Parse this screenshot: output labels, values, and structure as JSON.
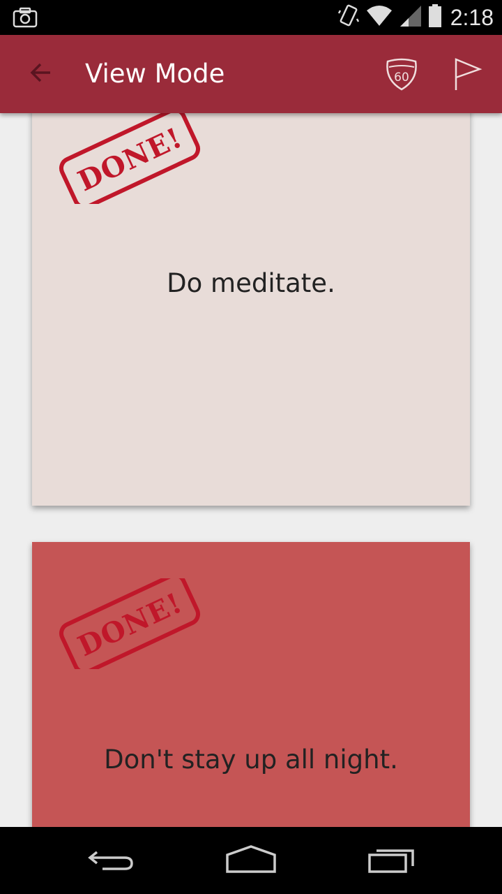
{
  "status_bar": {
    "time": "2:18",
    "icons": [
      "screenshot-icon",
      "vibrate-icon",
      "wifi-icon",
      "signal-icon",
      "battery-icon"
    ]
  },
  "app_bar": {
    "title": "View Mode",
    "back_icon": "arrow-back-icon",
    "badge_label": "60",
    "flag_icon": "flag-icon",
    "color": "#9a2b3a"
  },
  "cards": [
    {
      "text": "Do meditate.",
      "stamp": "DONE!",
      "color": "#e8dcd8"
    },
    {
      "text": "Don't stay up all night.",
      "stamp": "DONE!",
      "color": "#c55555"
    }
  ],
  "stamp_color": "#c0172a",
  "nav_bar": {
    "icons": [
      "nav-back-icon",
      "nav-home-icon",
      "nav-recents-icon"
    ]
  }
}
